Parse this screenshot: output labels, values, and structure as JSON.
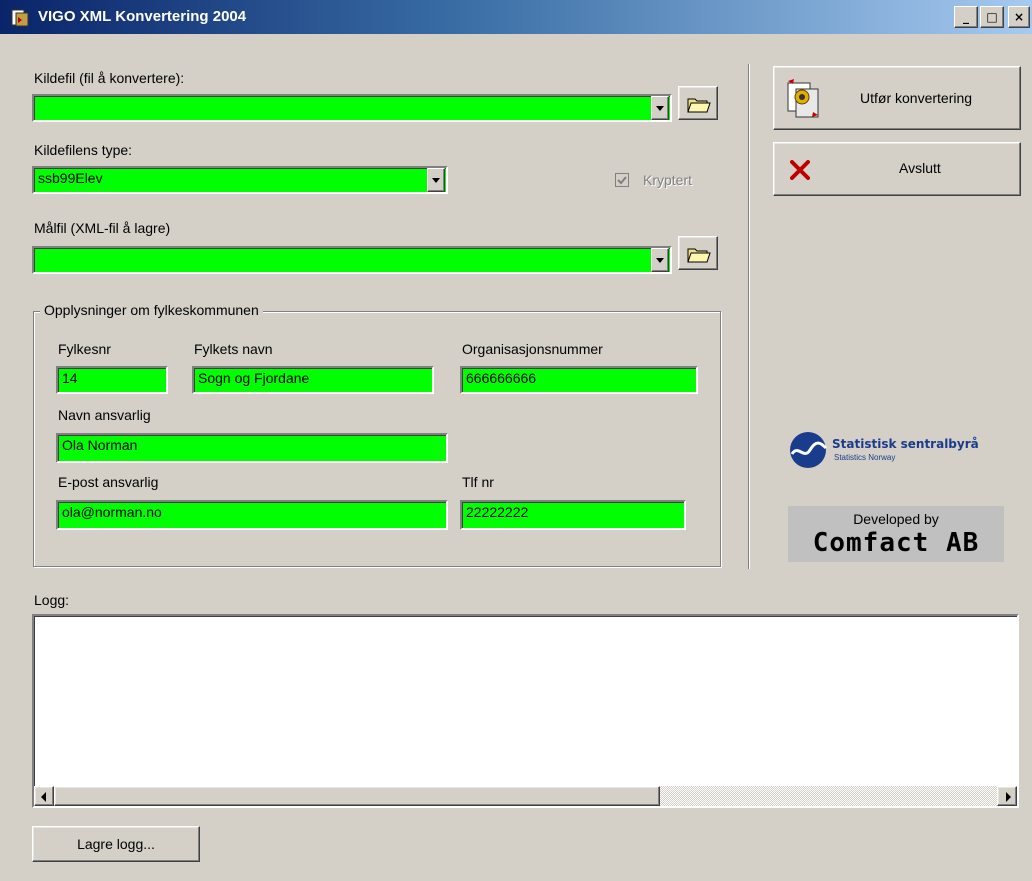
{
  "window": {
    "title": "VIGO XML Konvertering 2004",
    "controls": {
      "minimize": "_",
      "maximize": "□",
      "close": "×"
    }
  },
  "source": {
    "label": "Kildefil (fil å konvertere):",
    "value": "",
    "type_label": "Kildefilens type:",
    "type_value": "ssb99Elev",
    "encrypted_label": "Kryptert",
    "encrypted_checked": true
  },
  "target": {
    "label": "Målfil (XML-fil å lagre)",
    "value": ""
  },
  "county": {
    "group_label": "Opplysninger om fylkeskommunen",
    "nr_label": "Fylkesnr",
    "nr_value": "14",
    "name_label": "Fylkets navn",
    "name_value": "Sogn og Fjordane",
    "org_label": "Organisasjonsnummer",
    "org_value": "666666666",
    "resp_label": "Navn ansvarlig",
    "resp_value": "Ola Norman",
    "email_label": "E-post ansvarlig",
    "email_value": "ola@norman.no",
    "phone_label": "Tlf nr",
    "phone_value": "22222222"
  },
  "actions": {
    "convert_label": "Utfør konvertering",
    "exit_label": "Avslutt"
  },
  "branding": {
    "ssb_name": "Statistisk sentralbyrå",
    "ssb_sub": "Statistics Norway",
    "developed_by": "Developed by",
    "company": "Comfact AB"
  },
  "log": {
    "label": "Logg:",
    "content": "",
    "save_label": "Lagre logg..."
  },
  "colors": {
    "field_green": "#00ff00",
    "titlebar_start": "#0a246a",
    "titlebar_end": "#a6caf0",
    "face": "#d4d0c8"
  }
}
